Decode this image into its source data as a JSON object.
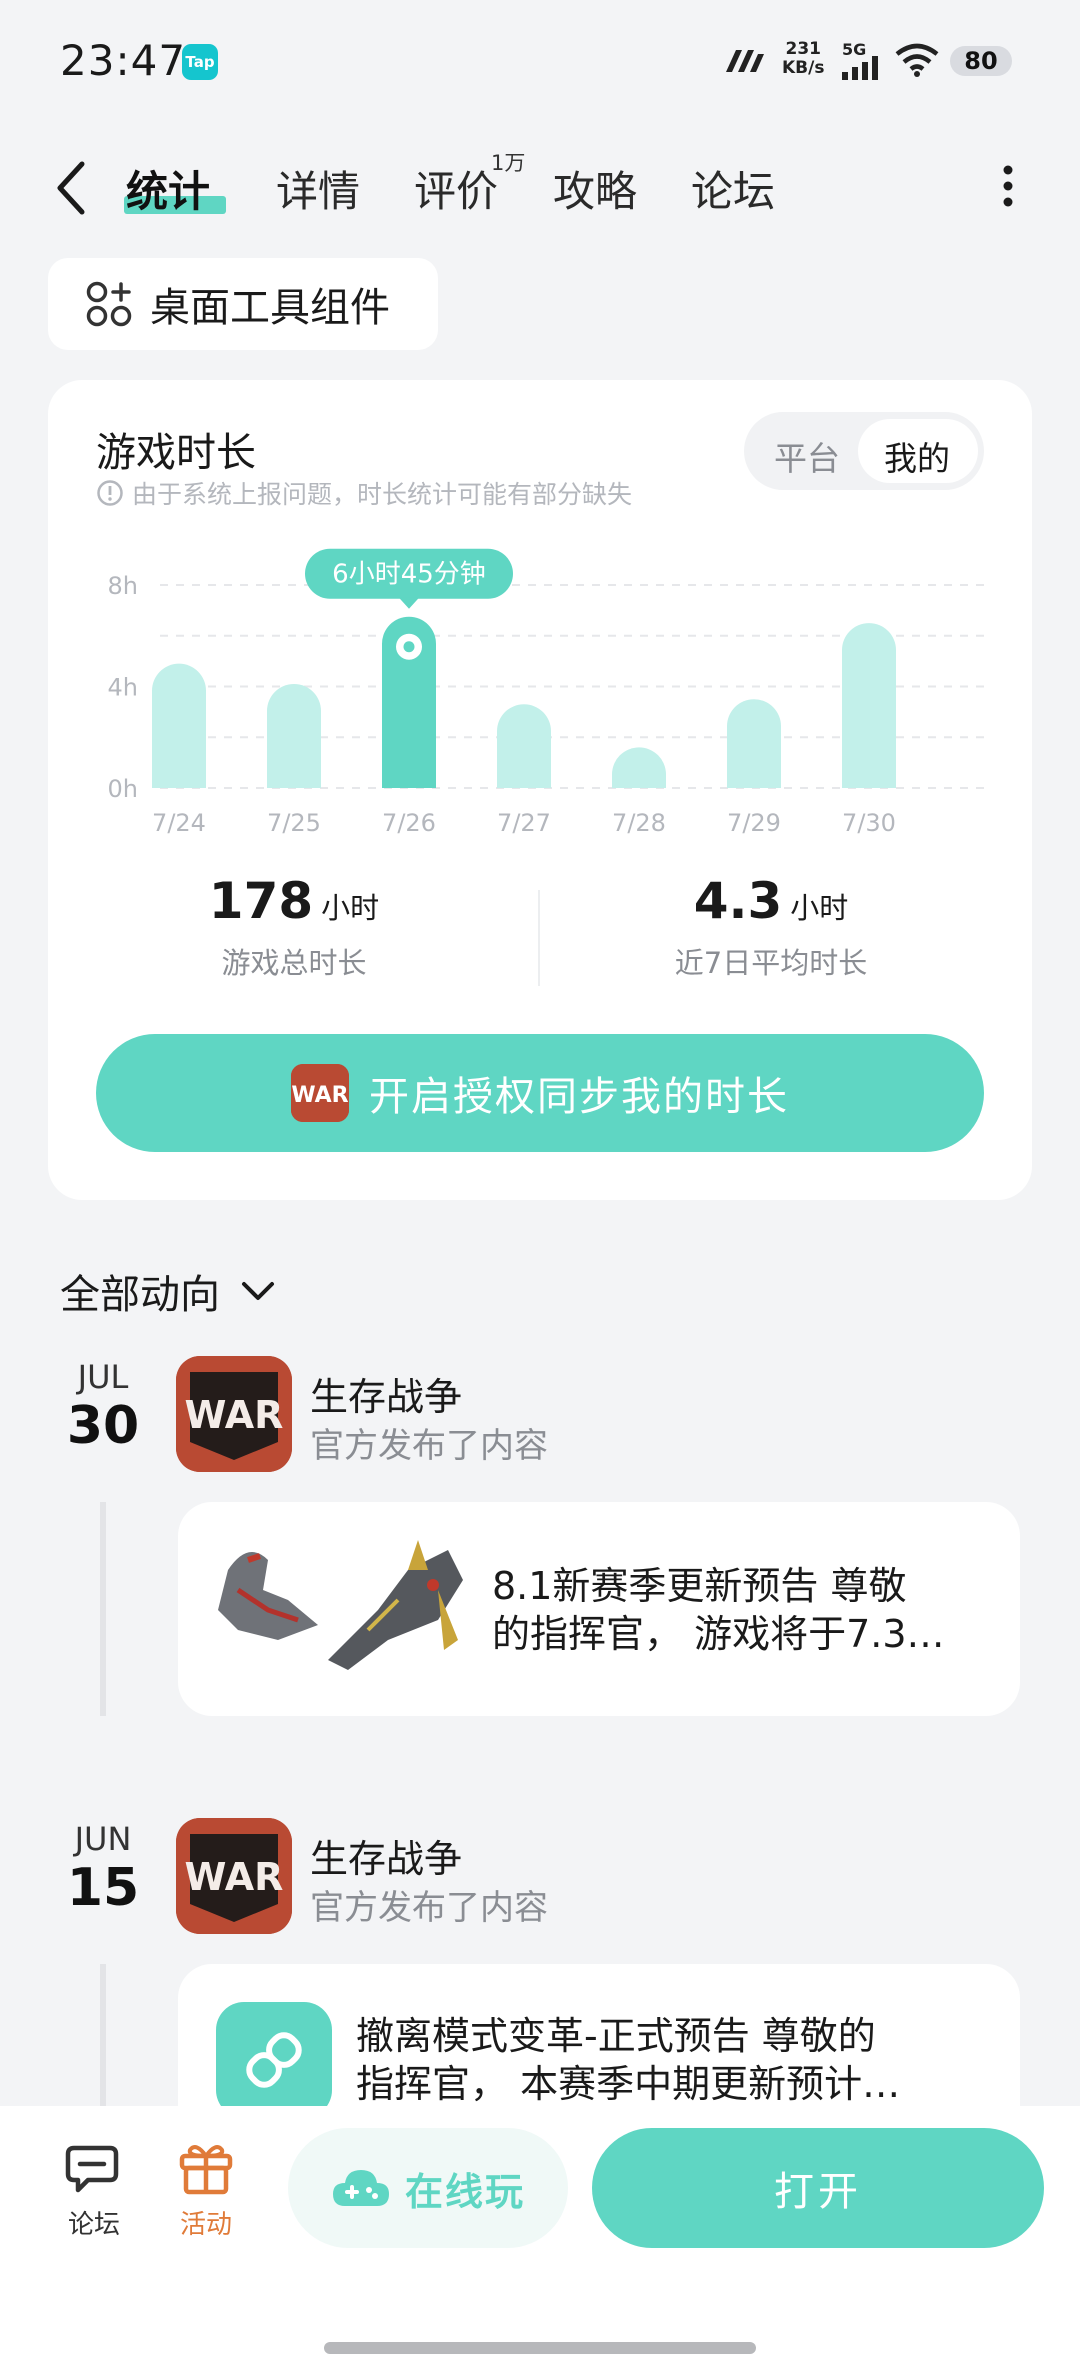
{
  "status_bar": {
    "time": "23:47",
    "app_badge": "Tap",
    "net_speed_value": "231",
    "net_speed_unit": "KB/s",
    "network": "5G",
    "battery": "80"
  },
  "nav": {
    "tabs": [
      {
        "label": "统计",
        "active": true
      },
      {
        "label": "详情",
        "active": false
      },
      {
        "label": "评价",
        "active": false,
        "badge": "1万"
      },
      {
        "label": "攻略",
        "active": false
      },
      {
        "label": "论坛",
        "active": false
      }
    ]
  },
  "widget_button": {
    "label": "桌面工具组件"
  },
  "stats_card": {
    "title": "游戏时长",
    "note": "由于系统上报问题，时长统计可能有部分缺失",
    "segment": {
      "options": [
        "平台",
        "我的"
      ],
      "selected": "我的"
    },
    "tooltip": "6小时45分钟",
    "total": {
      "value": "178",
      "unit": "小时",
      "label": "游戏总时长"
    },
    "average": {
      "value": "4.3",
      "unit": "小时",
      "label": "近7日平均时长"
    },
    "sync_button": "开启授权同步我的时长",
    "accent_color": "#5fd6c3",
    "bar_color": "#c2f0ea"
  },
  "chart_data": {
    "type": "bar",
    "categories": [
      "7/24",
      "7/25",
      "7/26",
      "7/27",
      "7/28",
      "7/29",
      "7/30"
    ],
    "values": [
      4.9,
      4.1,
      6.75,
      3.3,
      1.6,
      3.5,
      6.5
    ],
    "y_ticks": [
      "0h",
      "4h",
      "8h"
    ],
    "ylim": [
      0,
      8
    ],
    "grid": true,
    "highlight_index": 2
  },
  "feed": {
    "header": "全部动向",
    "items": [
      {
        "month": "JUL",
        "day": "30",
        "game": "生存战争",
        "sub": "官方发布了内容",
        "post_line1": "8.1新赛季更新预告 尊敬",
        "post_line2": "的指挥官， 游戏将于7.3…",
        "thumb_icon": "mech-thumbnail"
      },
      {
        "month": "JUN",
        "day": "15",
        "game": "生存战争",
        "sub": "官方发布了内容",
        "post_line1": "撤离模式变革-正式预告 尊敬的",
        "post_line2": "指挥官， 本赛季中期更新预计…",
        "thumb_icon": "link-icon"
      }
    ]
  },
  "bottom_bar": {
    "forum_label": "论坛",
    "activity_label": "活动",
    "online_play_label": "在线玩",
    "open_label": "打开"
  }
}
